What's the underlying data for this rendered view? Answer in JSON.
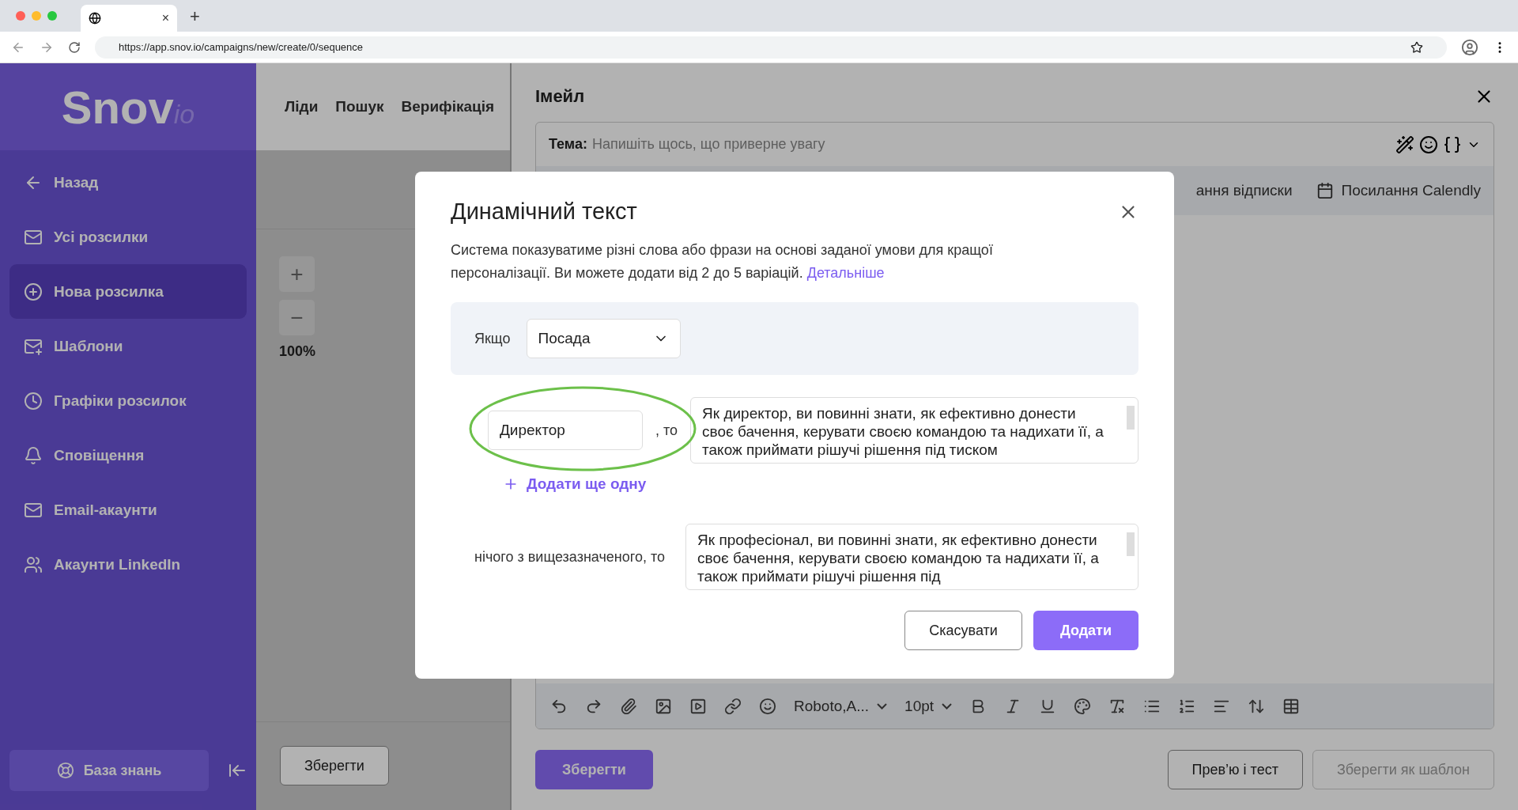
{
  "browser": {
    "tab_close": "×",
    "new_tab": "+",
    "url": "https://app.snov.io/campaigns/new/create/0/sequence"
  },
  "sidebar": {
    "logo": {
      "main": "Snov",
      "suffix": "io"
    },
    "items": [
      {
        "label": "Назад",
        "selected": false
      },
      {
        "label": "Усі розсилки",
        "selected": false
      },
      {
        "label": "Нова розсилка",
        "selected": true
      },
      {
        "label": "Шаблони",
        "selected": false
      },
      {
        "label": "Графіки розсилок",
        "selected": false
      },
      {
        "label": "Сповіщення",
        "selected": false
      },
      {
        "label": "Email-акаунти",
        "selected": false
      },
      {
        "label": "Акаунти LinkedIn",
        "selected": false
      }
    ],
    "knowledge_base": "База знань"
  },
  "top_nav": [
    "Ліди",
    "Пошук",
    "Верифікація"
  ],
  "canvas": {
    "zoom_in": "+",
    "zoom_out": "−",
    "zoom_level": "100%",
    "save_button": "Зберегти"
  },
  "email_panel": {
    "title": "Імейл",
    "subject_label": "Тема:",
    "subject_placeholder": "Напишіть щось, що приверне увагу",
    "links": [
      "ання відписки",
      "Посилання Calendly"
    ],
    "font": "Roboto,A...",
    "font_size": "10pt",
    "buttons": [
      {
        "label": "Зберегти",
        "kind": "primary",
        "disabled": false
      },
      {
        "label": "Прев’ю і тест",
        "kind": "secondary",
        "disabled": false
      },
      {
        "label": "Зберегти як шаблон",
        "kind": "secondary",
        "disabled": true
      }
    ]
  },
  "modal": {
    "title": "Динамічний текст",
    "description": "Система показуватиме різні слова або фрази на основі заданої умови для кращої персоналізації. Ви можете додати від 2 до 5 варіацій.",
    "link": "Детальніше",
    "condition_label": "Якщо",
    "condition_value": "Посада",
    "variants": [
      {
        "value": "Директор",
        "suffix": ", то",
        "text": "Як директор, ви повинні знати, як ефективно донести своє бачення, керувати своєю командою та надихати її, а також приймати рішучі рішення під тиском"
      }
    ],
    "add_variant": "Додати ще одну",
    "fallback": {
      "label": "нічого з вищезазначеного, то",
      "text": "Як професіонал, ви повинні знати, як ефективно донести своє бачення, керувати своєю командою та надихати її, а також приймати рішучі рішення під"
    },
    "cancel": "Скасувати",
    "submit": "Додати"
  }
}
